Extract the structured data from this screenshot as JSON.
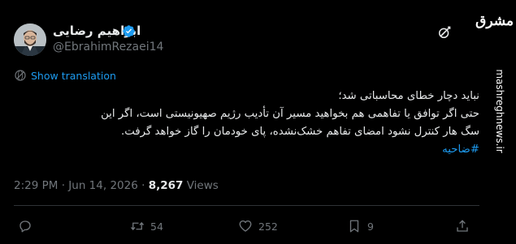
{
  "author": {
    "display_name": "ابراهیم رضایی",
    "handle": "@EbrahimRezaei14",
    "verified": true
  },
  "translate": {
    "label": "Show translation"
  },
  "tweet": {
    "lines": [
      "نباید دچار خطای محاسباتی شد؛",
      "حتی اگر توافق یا تفاهمی هم بخواهید مسیر آن تأدیب رژیم صهیونیستی است، اگر این",
      "سگ هار کنترل نشود امضای تفاهم خشک‌نشده، پای خودمان را گاز خواهد گرفت."
    ],
    "hashtag": "#ضاحیه"
  },
  "meta": {
    "time": "2:29 PM",
    "separator": "·",
    "date": "Jun 14, 2026",
    "views_count": "8,267",
    "views_label": "Views"
  },
  "actions": {
    "reply_count": "",
    "retweet_count": "54",
    "like_count": "252",
    "bookmark_count": "9"
  },
  "watermark": {
    "logo": "مشرق",
    "site": "mashreghnews.ir"
  },
  "colors": {
    "background": "#000000",
    "text": "#e7e9ea",
    "muted": "#71767b",
    "accent": "#1d9bf0"
  }
}
